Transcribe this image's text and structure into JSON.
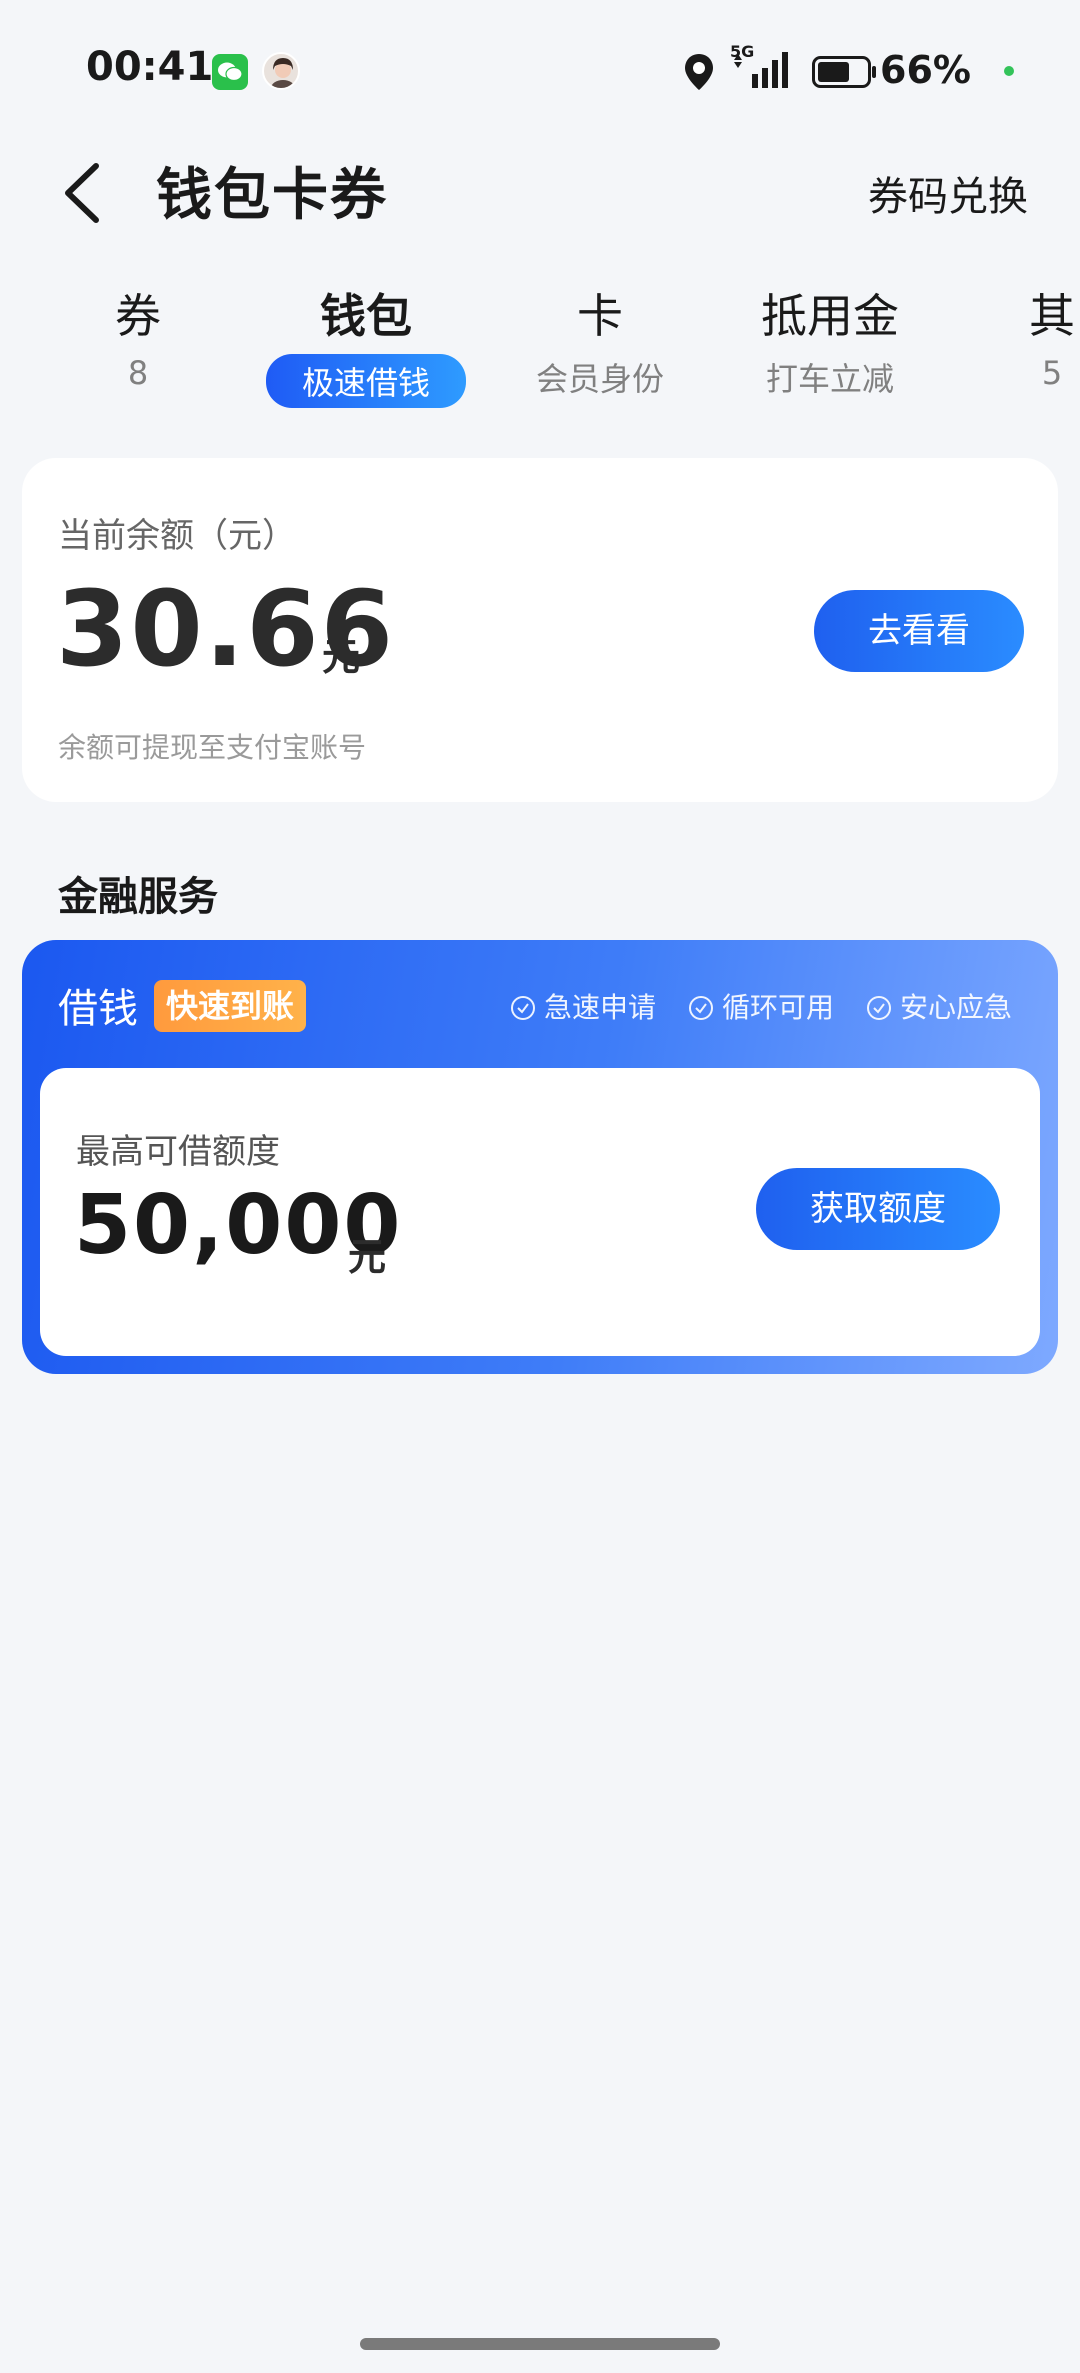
{
  "status_bar": {
    "time": "00:41",
    "network": "5G",
    "battery_pct": "66%",
    "battery_level": 0.66
  },
  "nav": {
    "title": "钱包卡券",
    "action": "券码兑换"
  },
  "tabs": [
    {
      "title": "券",
      "sub": "8"
    },
    {
      "title": "钱包",
      "sub": "极速借钱",
      "active": true
    },
    {
      "title": "卡",
      "sub": "会员身份"
    },
    {
      "title": "抵用金",
      "sub": "打车立减"
    },
    {
      "title": "其",
      "sub": "5"
    }
  ],
  "balance": {
    "label": "当前余额（元）",
    "amount": "30.66",
    "unit": "元",
    "note": "余额可提现至支付宝账号",
    "button": "去看看"
  },
  "finance": {
    "section_title": "金融服务",
    "loan_title": "借钱",
    "badge": "快速到账",
    "features": [
      "急速申请",
      "循环可用",
      "安心应急"
    ],
    "limit_label": "最高可借额度",
    "limit_amount": "50,000",
    "unit": "元",
    "button": "获取额度"
  },
  "colors": {
    "accent": "#1f60ef",
    "badge": "#ff9a3d",
    "background": "#f4f6f9"
  }
}
